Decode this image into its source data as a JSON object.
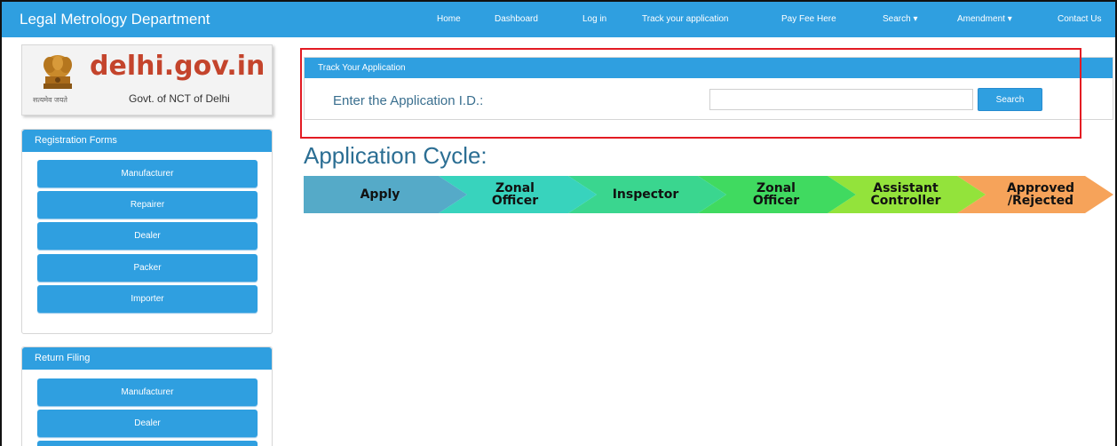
{
  "navbar": {
    "brand": "Legal Metrology Department",
    "items": [
      {
        "label": "Home"
      },
      {
        "label": "Dashboard"
      },
      {
        "label": "Log in"
      },
      {
        "label": "Track your application"
      },
      {
        "label": "Pay Fee Here"
      },
      {
        "label": "Search"
      },
      {
        "label": "Amendment"
      },
      {
        "label": "Contact Us"
      }
    ],
    "dropdown_caret": "▾",
    "color": "#2f9fe0"
  },
  "logo": {
    "main": "delhi.gov.in",
    "sub": "Govt. of NCT of Delhi",
    "hindi": "सत्यमेव जयते",
    "emblem_icon": "ashoka-emblem-icon"
  },
  "sidebar": {
    "registration": {
      "title": "Registration Forms",
      "items": [
        {
          "label": "Manufacturer"
        },
        {
          "label": "Repairer"
        },
        {
          "label": "Dealer"
        },
        {
          "label": "Packer"
        },
        {
          "label": "Importer"
        }
      ]
    },
    "return_filing": {
      "title": "Return Filing",
      "items": [
        {
          "label": "Manufacturer"
        },
        {
          "label": "Dealer"
        }
      ]
    }
  },
  "track": {
    "title": "Track Your Application",
    "label": "Enter the Application I.D.:",
    "input_value": "",
    "button": "Search"
  },
  "cycle": {
    "title": "Application Cycle:",
    "steps": [
      {
        "label": "Apply",
        "color": "#55aac8"
      },
      {
        "label": "Zonal\nOfficer",
        "color": "#38d3bd"
      },
      {
        "label": "Inspector",
        "color": "#3ad68f"
      },
      {
        "label": "Zonal\nOfficer",
        "color": "#40da60"
      },
      {
        "label": "Assistant\nController",
        "color": "#93e33b"
      },
      {
        "label": "Approved\n/Rejected",
        "color": "#f6a35a"
      }
    ]
  },
  "colors": {
    "accent": "#2f9fe0",
    "highlight": "#e31b23",
    "logo_red": "#c4442c"
  }
}
